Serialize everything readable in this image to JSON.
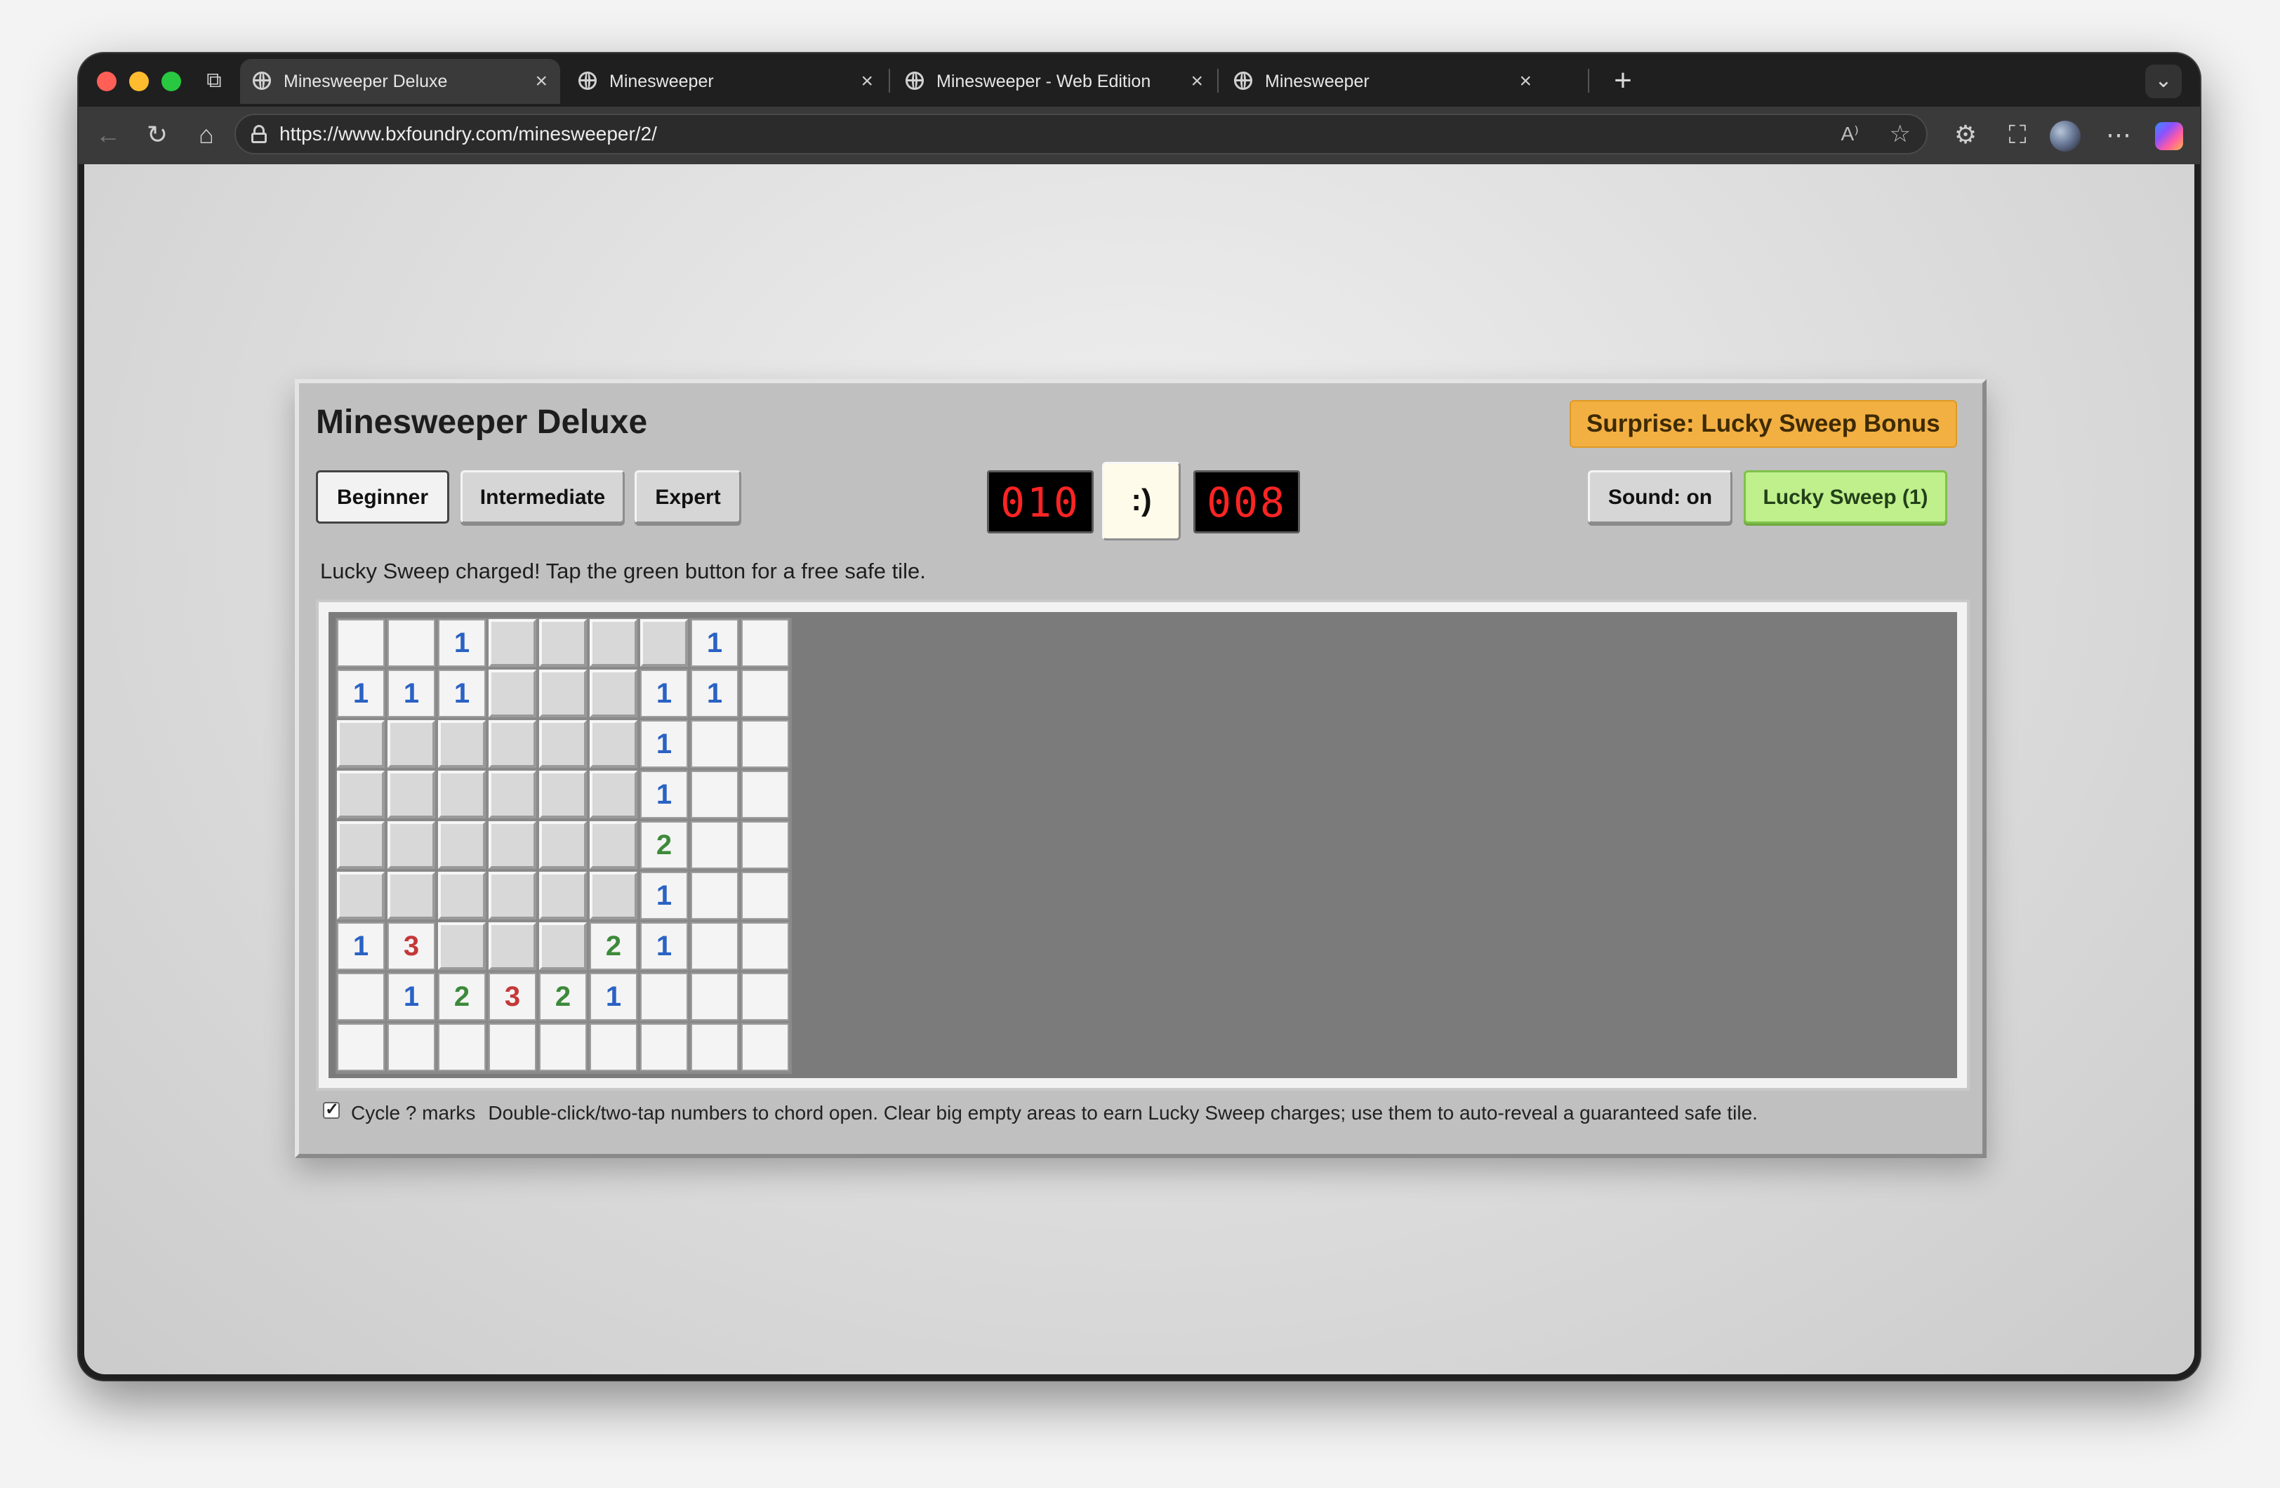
{
  "browser": {
    "tabs": [
      {
        "title": "Minesweeper Deluxe",
        "active": true
      },
      {
        "title": "Minesweeper",
        "active": false
      },
      {
        "title": "Minesweeper - Web Edition",
        "active": false
      },
      {
        "title": "Minesweeper",
        "active": false
      }
    ],
    "close_glyph": "×",
    "new_tab_glyph": "+",
    "url": "https://www.bxfoundry.com/minesweeper/2/"
  },
  "game": {
    "title": "Minesweeper Deluxe",
    "surprise_badge": "Surprise: Lucky Sweep Bonus",
    "difficulty": [
      {
        "label": "Beginner",
        "selected": true
      },
      {
        "label": "Intermediate",
        "selected": false
      },
      {
        "label": "Expert",
        "selected": false
      }
    ],
    "mine_counter": "010",
    "face": ":)",
    "timer": "008",
    "sound_label": "Sound: on",
    "lucky_label": "Lucky Sweep (1)",
    "status_message": "Lucky Sweep charged! Tap the green button for a free safe tile.",
    "board": {
      "rows": [
        [
          "o",
          "o",
          "1",
          "c",
          "c",
          "c",
          "c",
          "1",
          "o"
        ],
        [
          "1",
          "1",
          "1",
          "c",
          "c",
          "c",
          "1",
          "1",
          "o"
        ],
        [
          "c",
          "c",
          "c",
          "c",
          "c",
          "c",
          "1",
          "o",
          "o"
        ],
        [
          "c",
          "c",
          "c",
          "c",
          "c",
          "c",
          "1",
          "o",
          "o"
        ],
        [
          "c",
          "c",
          "c",
          "c",
          "c",
          "c",
          "2",
          "o",
          "o"
        ],
        [
          "c",
          "c",
          "c",
          "c",
          "c",
          "c",
          "1",
          "o",
          "o"
        ],
        [
          "1",
          "3",
          "c",
          "c",
          "c",
          "2",
          "1",
          "o",
          "o"
        ],
        [
          "o",
          "1",
          "2",
          "3",
          "2",
          "1",
          "o",
          "o",
          "o"
        ],
        [
          "o",
          "o",
          "o",
          "o",
          "o",
          "o",
          "o",
          "o",
          "o"
        ]
      ],
      "number_colors": {
        "1": "#2a62c4",
        "2": "#3c8a3a",
        "3": "#c43838"
      }
    },
    "cycle_marks_label": "Cycle ? marks",
    "cycle_marks_checked": true,
    "hint": "Double-click/two-tap numbers to chord open. Clear big empty areas to earn Lucky Sweep charges; use them to auto-reveal a guaranteed safe tile."
  },
  "colors": {
    "lucky_green": "#bff08c",
    "surprise_orange": "#f2b042",
    "lcd_red": "#ff2424"
  },
  "icons": [
    "workspaces-icon",
    "globe-icon",
    "back-icon",
    "reload-icon",
    "home-icon",
    "lock-icon",
    "read-aloud-icon",
    "favorite-star-icon",
    "extensions-icon",
    "screenshot-icon",
    "profile-avatar",
    "more-icon",
    "copilot-icon",
    "chevron-down-icon"
  ]
}
